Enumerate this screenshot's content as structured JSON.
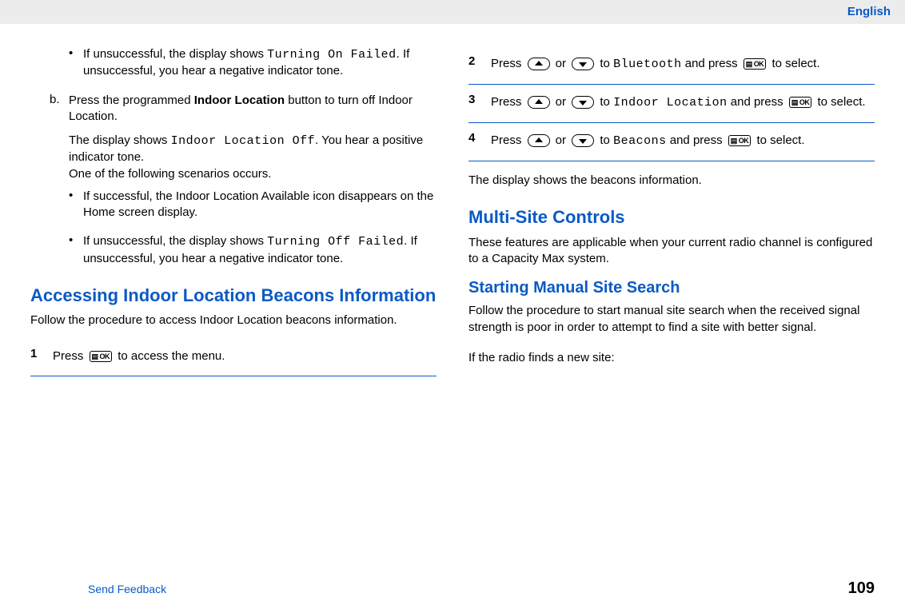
{
  "header": {
    "language": "English"
  },
  "left": {
    "bullet_a": {
      "pre": "If unsuccessful, the display shows ",
      "mono": "Turning On Failed",
      "post": ". If unsuccessful, you hear a negative indicator tone."
    },
    "step_b": {
      "marker": "b.",
      "line1_pre": "Press the programmed ",
      "line1_bold": "Indoor Location",
      "line1_post": " button to turn off Indoor Location.",
      "para2_pre": "The display shows ",
      "para2_mono": "Indoor Location Off",
      "para2_post": ". You hear a positive indicator tone.",
      "para3": "One of the following scenarios occurs.",
      "sub_bullets": [
        {
          "text": "If successful, the Indoor Location Available icon disappears on the Home screen display."
        },
        {
          "pre": "If unsuccessful, the display shows ",
          "mono": "Turning Off Failed",
          "post": ". If unsuccessful, you hear a negative indicator tone."
        }
      ]
    },
    "section_heading": "Accessing Indoor Location Beacons Information",
    "section_intro": "Follow the procedure to access Indoor Location beacons information.",
    "step1": {
      "num": "1",
      "pre": "Press ",
      "post": " to access the menu."
    }
  },
  "right": {
    "step2": {
      "num": "2",
      "pre": "Press ",
      "mid1": " or ",
      "mid2": " to ",
      "mono": "Bluetooth",
      "mid3": " and press ",
      "post": " to select."
    },
    "step3": {
      "num": "3",
      "pre": "Press ",
      "mid1": " or ",
      "mid2": " to ",
      "mono": "Indoor Location",
      "mid3": " and press ",
      "post": " to select."
    },
    "step4": {
      "num": "4",
      "pre": "Press ",
      "mid1": " or ",
      "mid2": " to ",
      "mono": "Beacons",
      "mid3": " and press ",
      "post": " to select."
    },
    "after_steps": "The display shows the beacons information.",
    "h2": "Multi-Site Controls",
    "h2_intro": "These features are applicable when your current radio channel is configured to a Capacity Max system.",
    "h3": "Starting Manual Site Search",
    "h3_intro": "Follow the procedure to start manual site search when the received signal strength is poor in order to attempt to find a site with better signal.",
    "tail": "If the radio finds a new site:"
  },
  "footer": {
    "feedback": "Send Feedback",
    "page": "109"
  },
  "icons": {
    "ok_label": "▤ OK"
  }
}
